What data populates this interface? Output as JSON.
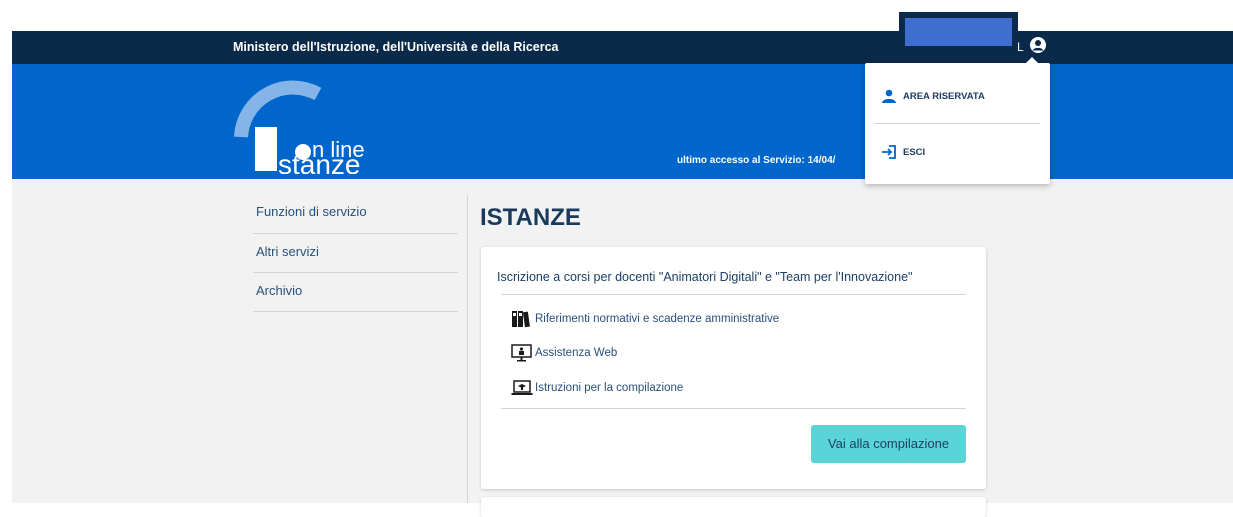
{
  "topbar": {
    "ministry": "Ministero dell'Istruzione, dell'Università e della Ricerca",
    "user_initial": "L"
  },
  "header": {
    "logo_line1": "n line",
    "logo_line2": "stanze",
    "last_access": "ultimo accesso al Servizio: 14/04/"
  },
  "sidenav": {
    "items": [
      {
        "label": "Funzioni di servizio"
      },
      {
        "label": "Altri servizi"
      },
      {
        "label": "Archivio"
      }
    ]
  },
  "main": {
    "title": "ISTANZE",
    "card": {
      "title": "Iscrizione a corsi per docenti \"Animatori Digitali\" e \"Team per l'Innovazione\"",
      "links": [
        {
          "label": "Riferimenti normativi e scadenze amministrative",
          "icon": "binders-icon"
        },
        {
          "label": "Assistenza Web",
          "icon": "assistance-monitor-icon"
        },
        {
          "label": "Istruzioni per la compilazione",
          "icon": "instructions-laptop-icon"
        }
      ],
      "cta_label": "Vai alla compilazione"
    }
  },
  "dropdown": {
    "items": [
      {
        "label": "AREA RISERVATA",
        "icon": "person-icon"
      },
      {
        "label": "ESCI",
        "icon": "logout-icon"
      }
    ]
  },
  "colors": {
    "topbar": "#0b2a4a",
    "header": "#0066cc",
    "cta": "#5bd4d8",
    "link": "#29507a"
  }
}
